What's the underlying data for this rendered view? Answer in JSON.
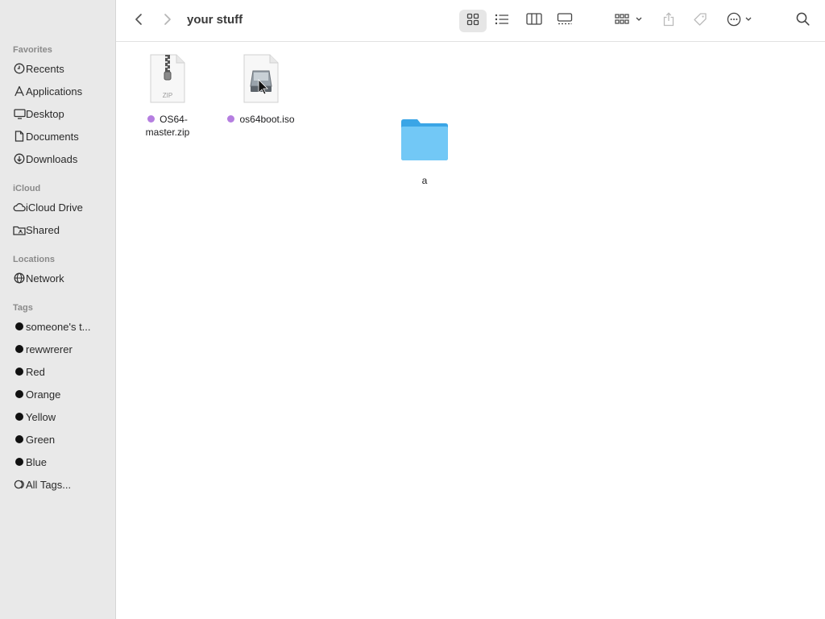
{
  "toolbar": {
    "title": "your stuff",
    "icons": [
      "back-icon",
      "forward-icon",
      "icon-view-icon",
      "list-view-icon",
      "column-view-icon",
      "gallery-view-icon",
      "group-icon",
      "share-icon",
      "tag-icon",
      "more-icon",
      "search-icon"
    ]
  },
  "sidebar": {
    "favorites_title": "Favorites",
    "favorites": [
      {
        "label": "Recents",
        "icon": "clock-icon"
      },
      {
        "label": "Applications",
        "icon": "applications-icon"
      },
      {
        "label": "Desktop",
        "icon": "desktop-icon"
      },
      {
        "label": "Documents",
        "icon": "document-icon"
      },
      {
        "label": "Downloads",
        "icon": "download-icon"
      }
    ],
    "icloud_title": "iCloud",
    "icloud": [
      {
        "label": "iCloud Drive",
        "icon": "cloud-icon"
      },
      {
        "label": "Shared",
        "icon": "shared-folder-icon"
      }
    ],
    "locations_title": "Locations",
    "locations": [
      {
        "label": "Network",
        "icon": "globe-icon"
      }
    ],
    "tags_title": "Tags",
    "tags": [
      {
        "label": "someone's t..."
      },
      {
        "label": "rewwrerer"
      },
      {
        "label": "Red"
      },
      {
        "label": "Orange"
      },
      {
        "label": "Yellow"
      },
      {
        "label": "Green"
      },
      {
        "label": "Blue"
      }
    ],
    "all_tags": "All Tags..."
  },
  "files": [
    {
      "name_line1": "OS64-",
      "name_line2": "master.zip",
      "icon": "zip-archive-icon",
      "tag_color": "#b57ee0",
      "icon_label": "ZIP"
    },
    {
      "name_line1": "os64boot.iso",
      "icon": "disk-image-icon",
      "tag_color": "#b57ee0"
    },
    {
      "name_line1": "a",
      "icon": "folder-icon"
    }
  ],
  "colors": {
    "sidebar_bg": "#e9e9e9",
    "folder_blue": "#5bbcf1",
    "tag_purple": "#b57ee0"
  }
}
